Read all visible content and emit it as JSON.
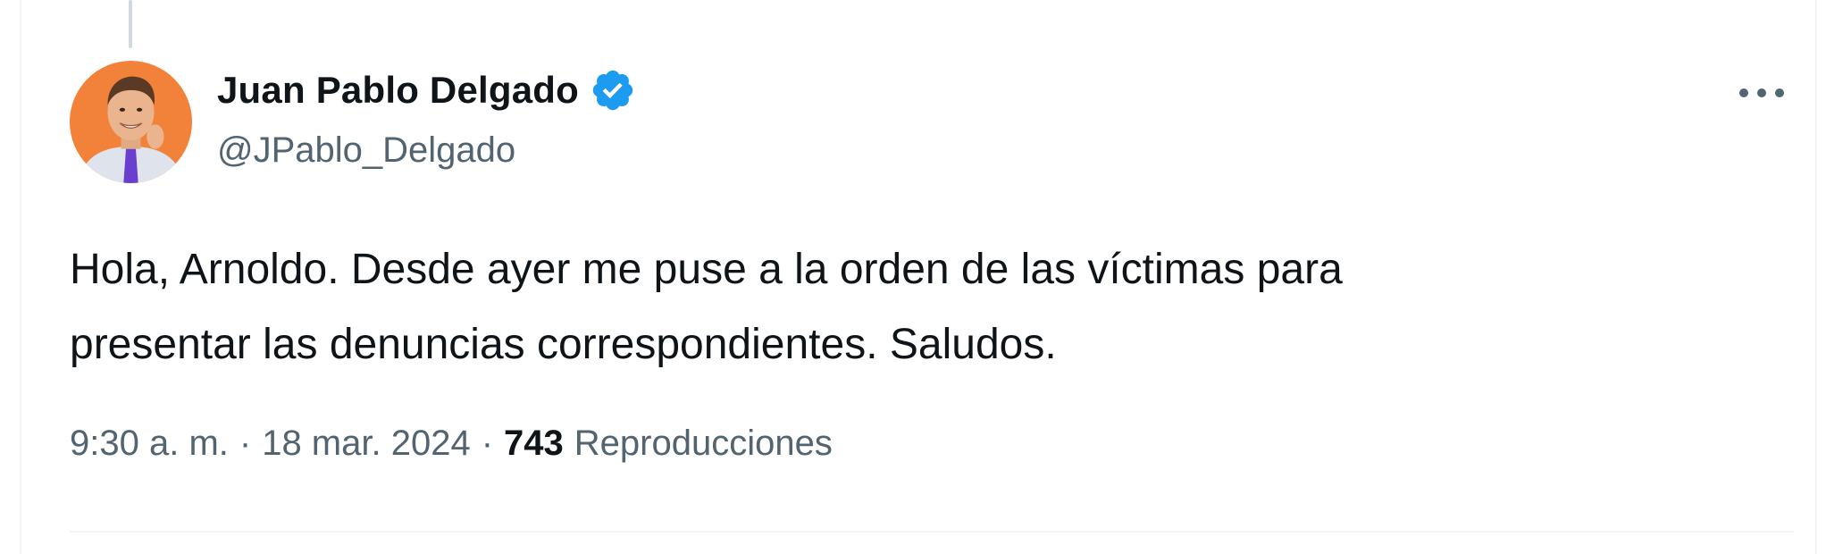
{
  "tweet": {
    "author": {
      "display_name": "Juan Pablo Delgado",
      "handle": "@JPablo_Delgado",
      "verified_icon": "verified-badge-icon"
    },
    "text_lines": [
      "Hola, Arnoldo. Desde ayer me puse a la orden de las víctimas para",
      "presentar las denuncias correspondientes. Saludos."
    ],
    "time": "9:30 a. m.",
    "separator": "·",
    "date": "18 mar. 2024",
    "views_count": "743",
    "views_label": "Reproducciones",
    "more_icon": "more-horizontal-icon"
  },
  "colors": {
    "text_primary": "#0f1419",
    "text_secondary": "#536471",
    "verified_blue": "#1d9bf0",
    "thread_line": "#cfd9de",
    "avatar_background": "#f2813a"
  }
}
